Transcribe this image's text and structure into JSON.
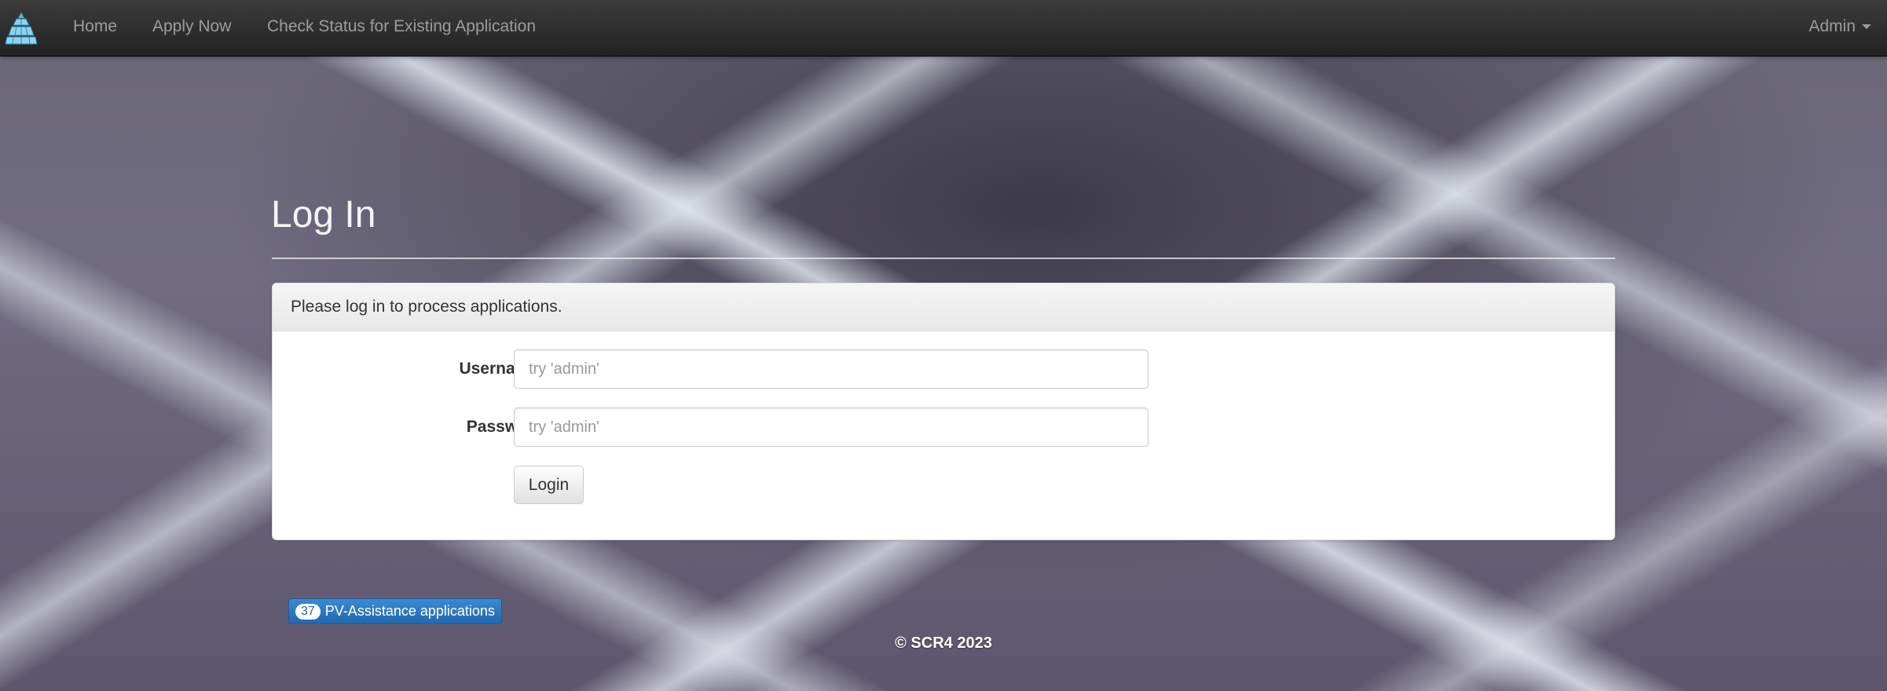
{
  "nav": {
    "home": "Home",
    "apply": "Apply Now",
    "status": "Check Status for Existing Application",
    "admin": "Admin"
  },
  "page": {
    "title": "Log In"
  },
  "panel": {
    "heading": "Please log in to process applications."
  },
  "form": {
    "username_label": "Username:",
    "username_placeholder": "try 'admin'",
    "password_label": "Password",
    "password_placeholder": "try 'admin'",
    "login_label": "Login"
  },
  "counter": {
    "count": "37",
    "label": "PV-Assistance applications"
  },
  "footer": {
    "text": "© SCR4 2023"
  },
  "icons": {
    "brand": "solar-panel-logo-icon",
    "admin_caret": "caret-down-icon"
  },
  "colors": {
    "navbar": "#222222",
    "nav_link": "#9d9d9d",
    "counter_bg": "#2a75bd",
    "brand": "#4fb3d9"
  }
}
